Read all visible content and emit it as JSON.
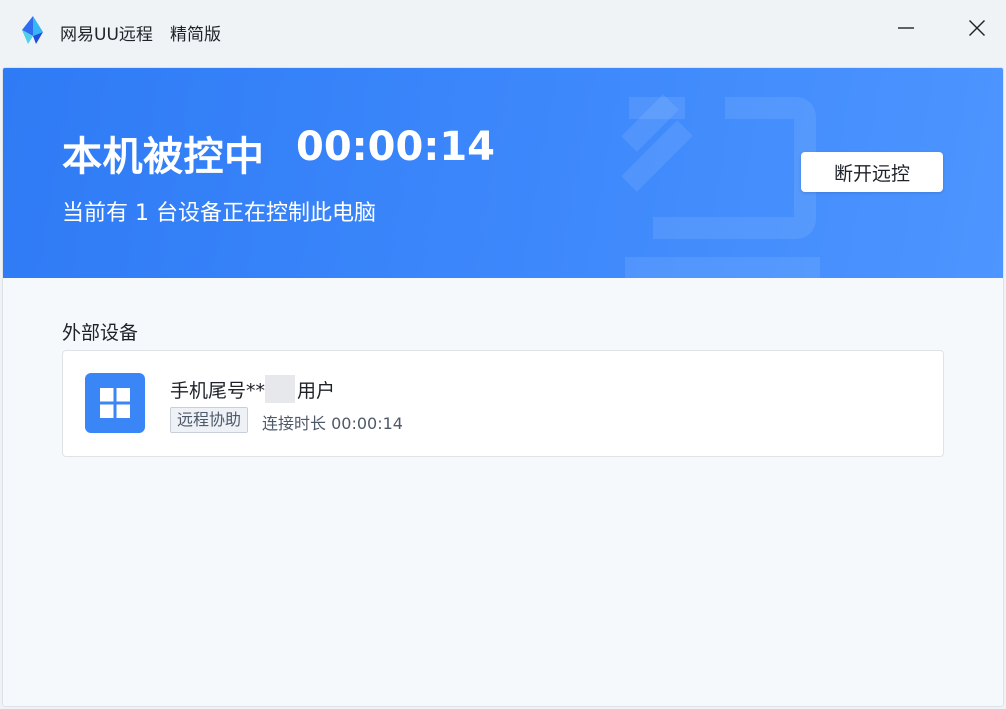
{
  "titlebar": {
    "app_name": "网易UU远程",
    "edition": "精简版",
    "logo_icon": "uu-remote-logo-icon",
    "minimize_icon": "minimize-icon",
    "close_icon": "close-icon"
  },
  "banner": {
    "status_title": "本机被控中",
    "timer": "00:00:14",
    "subtitle": "当前有 1 台设备正在控制此电脑",
    "disconnect_label": "断开远控",
    "background_color": "#3a86f7"
  },
  "external_devices": {
    "section_title": "外部设备",
    "items": [
      {
        "name_prefix": "手机尾号**",
        "name_suffix": "用户",
        "icon": "windows-icon",
        "tag": "远程协助",
        "duration": "连接时长 00:00:14"
      }
    ]
  }
}
